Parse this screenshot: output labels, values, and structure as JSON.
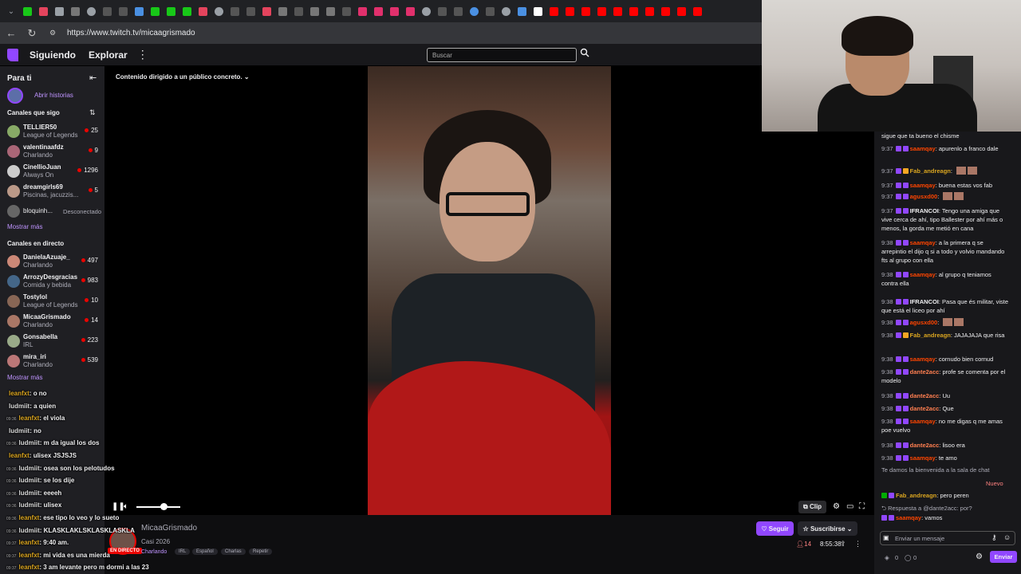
{
  "browser": {
    "url": "https://www.twitch.tv/micaagrismado"
  },
  "topnav": {
    "following": "Siguiendo",
    "explore": "Explorar",
    "more": "⋮",
    "search_placeholder": "Buscar"
  },
  "sidebar": {
    "for_you": "Para ti",
    "open_stories": "Abrir historias",
    "followed_title": "Canales que sigo",
    "followed": [
      {
        "name": "TELLIER50",
        "game": "League of Legends",
        "count": "25"
      },
      {
        "name": "valentinaafdz",
        "game": "Charlando",
        "count": "9"
      },
      {
        "name": "CinellioJuan",
        "game": "Always On",
        "count": "1296"
      },
      {
        "name": "dreamgirls69",
        "game": "Piscinas, jacuzzis...",
        "count": "5"
      },
      {
        "name": "bloquinh...",
        "game": "",
        "count": "Desconectado"
      }
    ],
    "show_more_1": "Mostrar más",
    "live_title": "Canales en directo",
    "live": [
      {
        "name": "DanielaAzuaje_",
        "game": "Charlando",
        "count": "497"
      },
      {
        "name": "ArrozyDesgracias",
        "game": "Comida y bebida",
        "count": "983"
      },
      {
        "name": "Tostylol",
        "game": "League of Legends",
        "count": "10"
      },
      {
        "name": "MicaaGrismado",
        "game": "Charlando",
        "count": "14"
      },
      {
        "name": "Gonsabella",
        "game": "IRL",
        "count": "223"
      },
      {
        "name": "mira_iri",
        "game": "Charlando",
        "count": "539"
      }
    ],
    "show_more_2": "Mostrar más"
  },
  "player": {
    "audience_label": "Contenido dirigido a un público concreto.",
    "clip": "Clip"
  },
  "overlay_chat": [
    {
      "time": "",
      "user": "leanfxt",
      "msg": "o no"
    },
    {
      "time": "",
      "user": "ludmiit",
      "msg": "a quien"
    },
    {
      "time": "09:36",
      "user": "leanfxt",
      "msg": "el viola"
    },
    {
      "time": "",
      "user": "ludmiit",
      "msg": "no"
    },
    {
      "time": "09:36",
      "user": "ludmiit",
      "msg": "m da igual los dos"
    },
    {
      "time": "",
      "user": "leanfxt",
      "msg": "ulisex JSJSJS"
    },
    {
      "time": "09:36",
      "user": "ludmiit",
      "msg": "osea son los pelotudos"
    },
    {
      "time": "09:36",
      "user": "ludmiit",
      "msg": "se los dije"
    },
    {
      "time": "09:36",
      "user": "ludmiit",
      "msg": "eeeeh"
    },
    {
      "time": "09:36",
      "user": "ludmiit",
      "msg": "ulisex"
    },
    {
      "time": "09:36",
      "user": "leanfxt",
      "msg": "ese tipo lo veo y lo sueto"
    },
    {
      "time": "09:36",
      "user": "ludmiit",
      "msg": "KLASKLAKLSKLASKLASKLA"
    },
    {
      "time": "09:37",
      "user": "leanfxt",
      "msg": "9:40 am."
    },
    {
      "time": "09:37",
      "user": "leanfxt",
      "msg": "mi vida es una mierda"
    },
    {
      "time": "09:37",
      "user": "leanfxt",
      "msg": "3 am levante pero m dormi a las 23"
    }
  ],
  "info": {
    "channel": "MicaaGrismado",
    "title": "Casi 2026",
    "category": "Charlando",
    "live_badge": "EN DIRECTO",
    "tags": [
      "IRL",
      "Español",
      "Charlas",
      "Repetir"
    ],
    "follow": "Seguir",
    "subscribe": "Suscribirse",
    "viewers": "14",
    "uptime": "8:55:38"
  },
  "chat": {
    "messages": [
      {
        "time": "",
        "user": "",
        "msg": "sigue que ta bueno el chisme"
      },
      {
        "time": "9:37",
        "user": "saamqay",
        "msg": "apurenlo a franco dale"
      },
      {
        "time": "9:37",
        "user": "Fab_andreagn",
        "msg": ""
      },
      {
        "time": "9:37",
        "user": "saamqay",
        "msg": "buena estas vos fab"
      },
      {
        "time": "9:37",
        "user": "agusxd00",
        "msg": ""
      },
      {
        "time": "9:37",
        "user": "IFRANCOI",
        "msg": "Tengo una amiga que vive cerca de ahí, tipo Ballester por ahí más o menos, la gorda me metió en cana"
      },
      {
        "time": "9:38",
        "user": "saamqay",
        "msg": "a la primera q se arrepintio el dijo q si a todo y volvio mandando fts al grupo con ella"
      },
      {
        "time": "9:38",
        "user": "saamqay",
        "msg": "al grupo q teniamos contra ella"
      },
      {
        "time": "9:38",
        "user": "IFRANCOI",
        "msg": "Pasa que és militar, viste que está el liceo por ahí"
      },
      {
        "time": "9:38",
        "user": "agusxd00",
        "msg": ""
      },
      {
        "time": "9:38",
        "user": "Fab_andreagn",
        "msg": "JAJAJAJA que risa"
      },
      {
        "time": "9:38",
        "user": "saamqay",
        "msg": "cornudo bien cornud"
      },
      {
        "time": "9:38",
        "user": "dante2acc",
        "msg": "profe se comenta por el modelo"
      },
      {
        "time": "9:38",
        "user": "dante2acc",
        "msg": "Uu"
      },
      {
        "time": "9:38",
        "user": "dante2acc",
        "msg": "Que"
      },
      {
        "time": "9:38",
        "user": "saamqay",
        "msg": "no me digas q me amas poe vuelvo"
      },
      {
        "time": "9:38",
        "user": "dante2acc",
        "msg": "lisoo era"
      },
      {
        "time": "9:38",
        "user": "saamqay",
        "msg": "te amo"
      }
    ],
    "welcome": "Te damos la bienvenida a la sala de chat",
    "new": "Nuevo",
    "pinned_user": "Fab_andreagn",
    "pinned_msg": "pero peren",
    "reply_label": "Respuesta a @dante2acc: por?",
    "reply_user": "saamqay",
    "reply_msg": "vamos",
    "input_placeholder": "Enviar un mensaje",
    "points_a": "0",
    "points_b": "0",
    "send": "Enviar"
  },
  "colors": {
    "brand": "#9147ff",
    "live": "#eb0400",
    "bg": "#0e0e10"
  }
}
